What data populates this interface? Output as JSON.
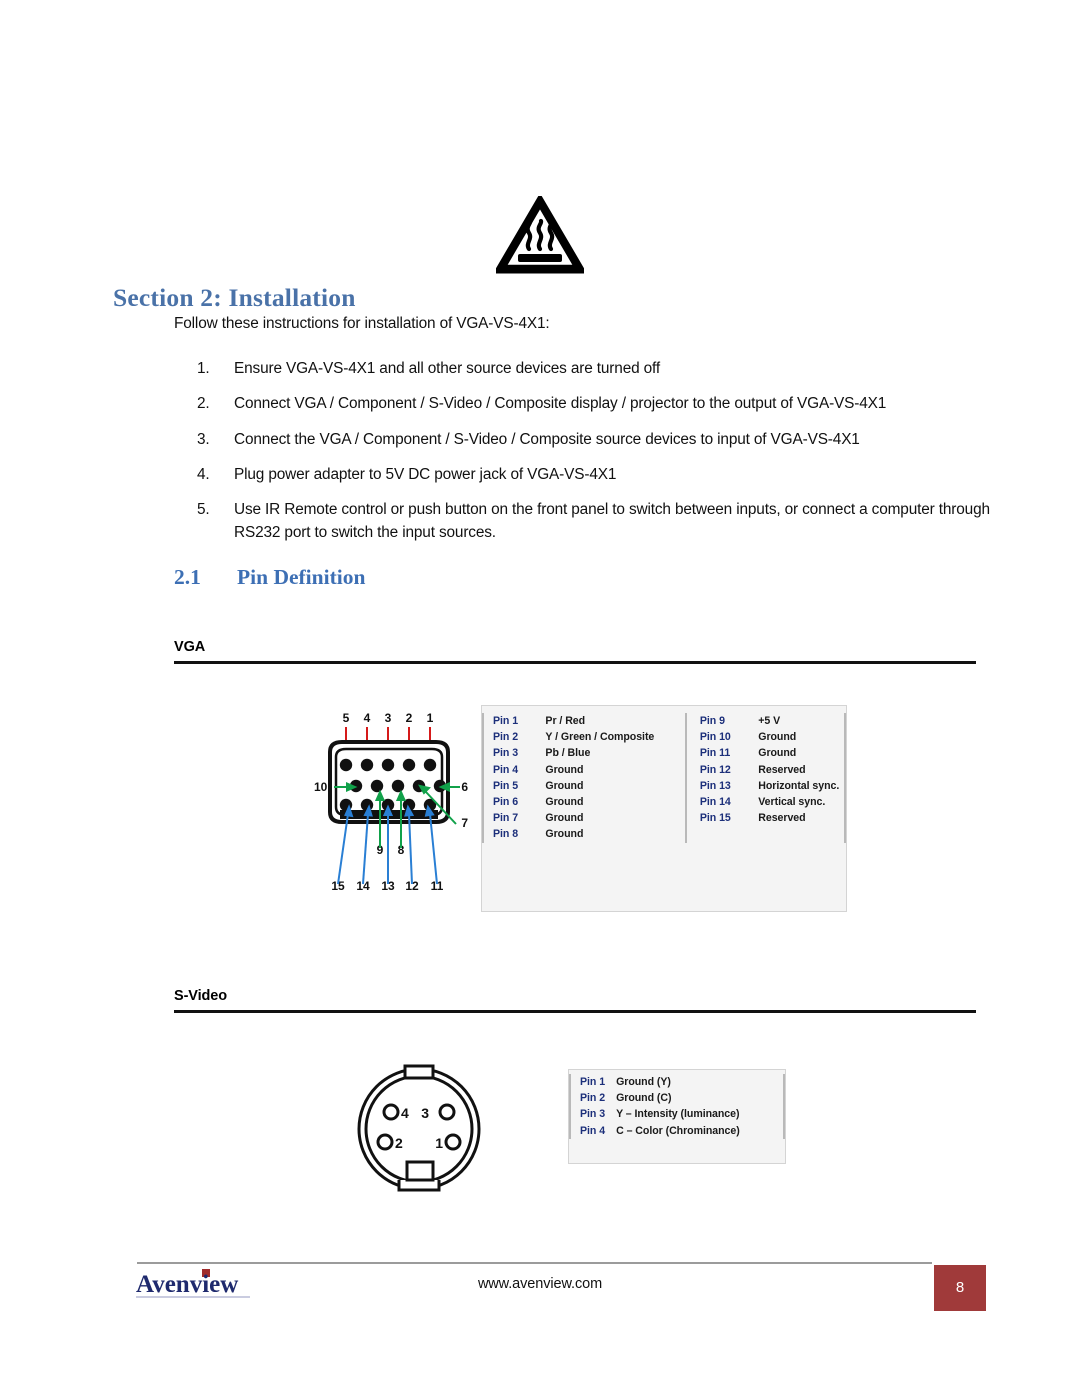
{
  "document": {
    "warning_icon": "hot-surface-warning-icon",
    "section_heading": "Section 2: Installation",
    "intro": "Follow these instructions for installation of VGA-VS-4X1:",
    "steps": [
      {
        "num": "1.",
        "text": "Ensure VGA-VS-4X1 and all other source devices are turned off"
      },
      {
        "num": "2.",
        "text": "Connect VGA / Component / S-Video / Composite display / projector to the output of VGA-VS-4X1"
      },
      {
        "num": "3.",
        "text": "Connect the VGA / Component / S-Video / Composite source devices to input of VGA-VS-4X1"
      },
      {
        "num": "4.",
        "text": "Plug power adapter to 5V DC power jack of VGA-VS-4X1"
      },
      {
        "num": "5.",
        "text": "Use IR Remote control or push button on the front panel to switch between inputs, or connect a computer through RS232 port to switch the input sources."
      }
    ],
    "subsection": {
      "number": "2.1",
      "title": "Pin Definition"
    },
    "vga": {
      "heading": "VGA",
      "connector_label": "db15-vga-connector",
      "connector_pin_numbers": {
        "top": [
          "5",
          "4",
          "3",
          "2",
          "1"
        ],
        "middle_left": "10",
        "middle_right": "6",
        "middle_callouts": [
          "9",
          "8",
          "7"
        ],
        "bottom": [
          "15",
          "14",
          "13",
          "12",
          "11"
        ]
      },
      "pins_left": [
        {
          "pin": "Pin 1",
          "value": "Pr / Red"
        },
        {
          "pin": "Pin 2",
          "value": "Y / Green / Composite"
        },
        {
          "pin": "Pin 3",
          "value": "Pb / Blue"
        },
        {
          "pin": "Pin 4",
          "value": "Ground"
        },
        {
          "pin": "Pin 5",
          "value": "Ground"
        },
        {
          "pin": "Pin 6",
          "value": "Ground"
        },
        {
          "pin": "Pin 7",
          "value": "Ground"
        },
        {
          "pin": "Pin 8",
          "value": "Ground"
        }
      ],
      "pins_right": [
        {
          "pin": "Pin 9",
          "value": "+5 V"
        },
        {
          "pin": "Pin 10",
          "value": "Ground"
        },
        {
          "pin": "Pin 11",
          "value": "Ground"
        },
        {
          "pin": "Pin 12",
          "value": "Reserved"
        },
        {
          "pin": "Pin 13",
          "value": "Horizontal sync."
        },
        {
          "pin": "Pin 14",
          "value": "Vertical sync."
        },
        {
          "pin": "Pin 15",
          "value": "Reserved"
        },
        {
          "pin": "",
          "value": ""
        }
      ]
    },
    "svideo": {
      "heading": "S-Video",
      "connector_label": "mini-din4-svideo-connector",
      "connector_pin_numbers": [
        "4",
        "3",
        "2",
        "1"
      ],
      "pins": [
        {
          "pin": "Pin 1",
          "value": "Ground (Y)"
        },
        {
          "pin": "Pin 2",
          "value": "Ground (C)"
        },
        {
          "pin": "Pin 3",
          "value": "Y – Intensity (luminance)"
        },
        {
          "pin": "Pin 4",
          "value": "C – Color (Chrominance)"
        }
      ]
    },
    "footer": {
      "logo_text": "Avenview",
      "url": "www.avenview.com",
      "page_number": "8"
    },
    "colors": {
      "heading_blue": "#4a72a8",
      "subheading_blue": "#3d6fb4",
      "pin_label_navy": "#1c2f7a",
      "page_badge_red": "#a03a3a",
      "logo_navy": "#1f2a6e",
      "logo_accent_red": "#a02c2c",
      "arrow_red": "#d51a1a",
      "arrow_green": "#11a14a",
      "arrow_blue": "#2a7fd4"
    }
  }
}
